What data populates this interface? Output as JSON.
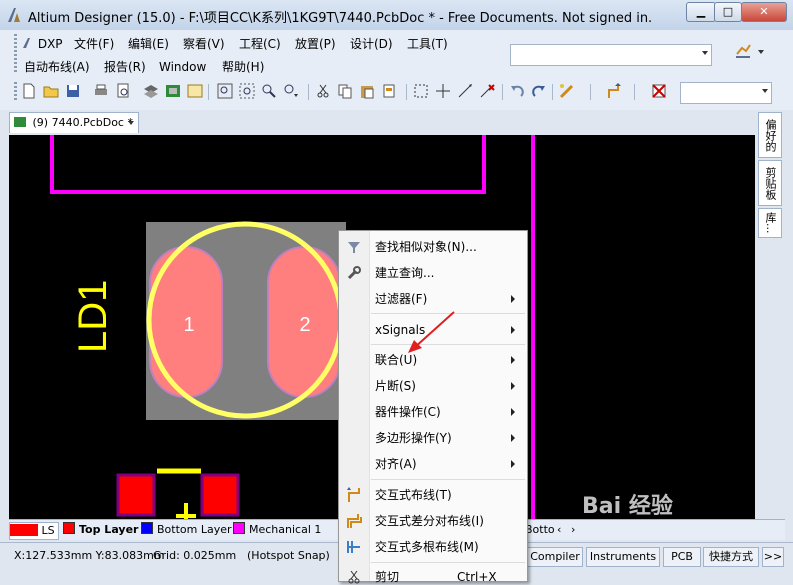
{
  "window": {
    "title": "Altium Designer (15.0) - F:\\项目CC\\K系列\\1KG9T\\7440.PcbDoc * - Free Documents. Not signed in.",
    "min_label": "▁",
    "max_label": "□",
    "close_label": "✕"
  },
  "menu": {
    "row1": [
      "DXP",
      "文件(F)",
      "编辑(E)",
      "察看(V)",
      "工程(C)",
      "放置(P)",
      "设计(D)",
      "工具(T)"
    ],
    "row2": [
      "自动布线(A)",
      "报告(R)",
      "Window",
      "帮助(H)"
    ]
  },
  "doc_tab": {
    "label": "(9) 7440.PcbDoc *"
  },
  "pcb": {
    "designator": "LD1",
    "pad1": "1",
    "pad2": "2",
    "colors": {
      "board_bg": "#000000",
      "magenta": "#ff00ff",
      "pad": "#ff7f7f",
      "silk": "#ffff66",
      "gray": "#808080"
    }
  },
  "right_panel": [
    "偏好的",
    "剪贴板",
    "库..."
  ],
  "layers": {
    "ls_label": "LS",
    "items": [
      {
        "name": "Top Layer",
        "color": "#ff0000"
      },
      {
        "name": "Bottom Layer",
        "color": "#0000ff"
      },
      {
        "name": "Mechanical 1",
        "color": "#ff00ff"
      }
    ],
    "tail": "Botto"
  },
  "status": {
    "coords": "X:127.533mm Y:83.083mm",
    "grid": "Grid: 0.025mm",
    "snap": "(Hotspot Snap)",
    "buttons": [
      "Compiler",
      "Instruments",
      "PCB",
      "快捷方式",
      ">>"
    ]
  },
  "context_menu": {
    "items": [
      {
        "label": "查找相似对象(N)...",
        "submenu": false,
        "icon": "funnel-icon"
      },
      {
        "label": "建立查询...",
        "submenu": false,
        "icon": "query-icon"
      },
      {
        "label": "过滤器(F)",
        "submenu": true,
        "icon": ""
      },
      {
        "label": "xSignals",
        "submenu": true,
        "icon": ""
      },
      {
        "label": "联合(U)",
        "submenu": true,
        "icon": ""
      },
      {
        "label": "片断(S)",
        "submenu": true,
        "icon": ""
      },
      {
        "label": "器件操作(C)",
        "submenu": true,
        "icon": ""
      },
      {
        "label": "多边形操作(Y)",
        "submenu": true,
        "icon": ""
      },
      {
        "label": "对齐(A)",
        "submenu": true,
        "icon": ""
      },
      {
        "label": "交互式布线(T)",
        "submenu": false,
        "icon": "route-icon"
      },
      {
        "label": "交互式差分对布线(I)",
        "submenu": false,
        "icon": "diff-route-icon"
      },
      {
        "label": "交互式多根布线(M)",
        "submenu": false,
        "icon": "multi-route-icon"
      },
      {
        "label": "剪切",
        "submenu": false,
        "icon": "scissors-icon"
      }
    ],
    "shortcut_partial": "Ctrl+X"
  },
  "watermark": "Bai 经验"
}
